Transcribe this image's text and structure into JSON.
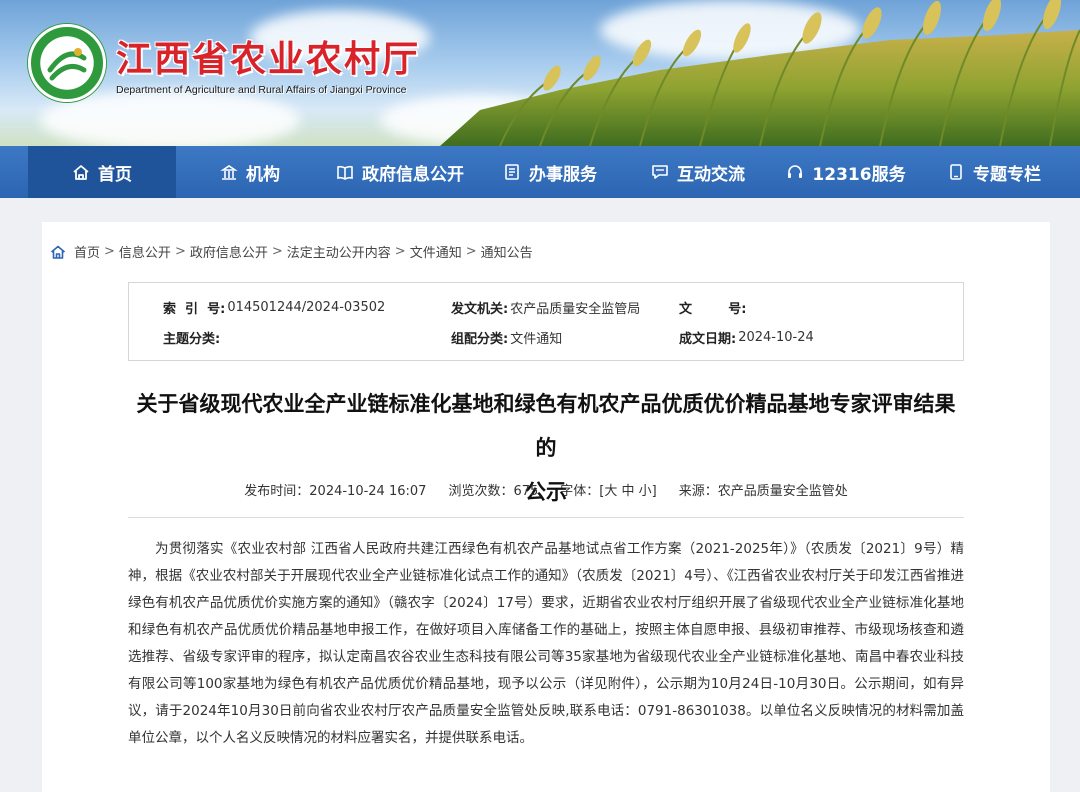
{
  "site": {
    "title": "江西省农业农村厅",
    "subtitle": "Department of Agriculture and Rural Affairs of Jiangxi Province"
  },
  "nav": [
    {
      "label": "首页",
      "icon": "home-icon",
      "active": true
    },
    {
      "label": "机构",
      "icon": "institution-icon",
      "active": false
    },
    {
      "label": "政府信息公开",
      "icon": "book-icon",
      "active": false
    },
    {
      "label": "办事服务",
      "icon": "document-icon",
      "active": false
    },
    {
      "label": "互动交流",
      "icon": "chat-icon",
      "active": false
    },
    {
      "label": "12316服务",
      "icon": "headset-icon",
      "active": false
    },
    {
      "label": "专题专栏",
      "icon": "tablet-icon",
      "active": false
    }
  ],
  "breadcrumb": [
    "首页",
    "信息公开",
    "政府信息公开",
    "法定主动公开内容",
    "文件通知",
    "通知公告"
  ],
  "meta": {
    "index_label": "索  引  号:",
    "index_value": "014501244/2024-03502",
    "issuer_label": "发文机关:",
    "issuer_value": "农产品质量安全监管局",
    "docno_label": "文        号:",
    "docno_value": "",
    "topic_label": "主题分类:",
    "topic_value": "",
    "category_label": "组配分类:",
    "category_value": "文件通知",
    "date_label": "成文日期:",
    "date_value": "2024-10-24"
  },
  "article": {
    "title_line1": "关于省级现代农业全产业链标准化基地和绿色有机农产品优质优价精品基地专家评审结果的",
    "title_line2": "公示",
    "publish_time": "发布时间：2024-10-24 16:07",
    "views": "浏览次数：675",
    "font_size": "字体：[大 中 小]",
    "source": "来源：农产品质量安全监管处",
    "paragraph": "为贯彻落实《农业农村部 江西省人民政府共建江西绿色有机农产品基地试点省工作方案（2021-2025年）》（农质发〔2021〕9号）精神，根据《农业农村部关于开展现代农业全产业链标准化试点工作的通知》（农质发〔2021〕4号）、《江西省农业农村厅关于印发江西省推进绿色有机农产品优质优价实施方案的通知》（赣农字〔2024〕17号）要求，近期省农业农村厅组织开展了省级现代农业全产业链标准化基地和绿色有机农产品优质优价精品基地申报工作，在做好项目入库储备工作的基础上，按照主体自愿申报、县级初审推荐、市级现场核查和遴选推荐、省级专家评审的程序，拟认定南昌农谷农业生态科技有限公司等35家基地为省级现代农业全产业链标准化基地、南昌中春农业科技有限公司等100家基地为绿色有机农产品优质优价精品基地，现予以公示（详见附件），公示期为10月24日-10月30日。公示期间，如有异议，请于2024年10月30日前向省农业农村厅农产品质量安全监管处反映,联系电话：0791-86301038。以单位名义反映情况的材料需加盖单位公章，以个人名义反映情况的材料应署实名，并提供联系电话。"
  },
  "colors": {
    "nav_bg": "#2c66b2",
    "nav_active": "#20549a",
    "title_red": "#d8232a",
    "logo_green": "#2f9a3d"
  }
}
